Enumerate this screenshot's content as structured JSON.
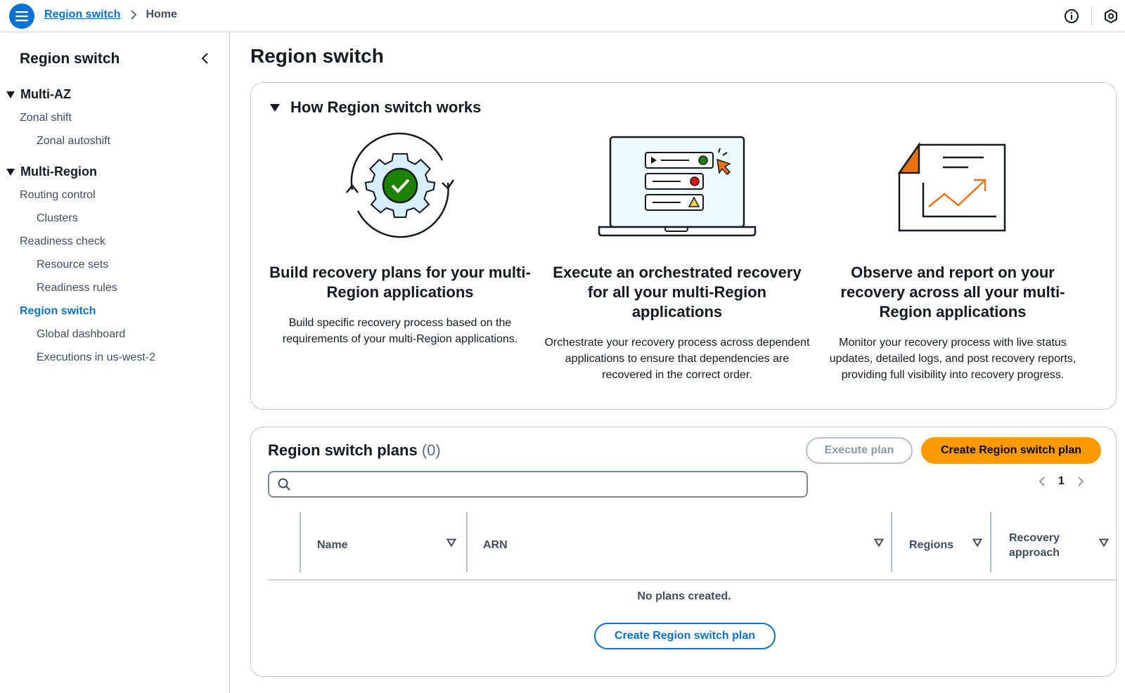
{
  "header": {
    "breadcrumb_link": "Region switch",
    "breadcrumb_current": "Home"
  },
  "sidebar": {
    "title": "Region switch",
    "sections": [
      {
        "label": "Multi-AZ"
      },
      {
        "label": "Multi-Region"
      }
    ],
    "items": [
      {
        "label": "Zonal shift"
      },
      {
        "label": "Zonal autoshift"
      },
      {
        "label": "Routing control"
      },
      {
        "label": "Clusters"
      },
      {
        "label": "Readiness check"
      },
      {
        "label": "Resource sets"
      },
      {
        "label": "Readiness rules"
      },
      {
        "label": "Region switch"
      },
      {
        "label": "Global dashboard"
      },
      {
        "label": "Executions in us-west-2"
      }
    ]
  },
  "main": {
    "title": "Region switch",
    "how": {
      "header": "How Region switch works",
      "features": [
        {
          "title": "Build recovery plans for your multi-Region applications",
          "desc": "Build specific recovery process based on the requirements of your multi-Region applications."
        },
        {
          "title": "Execute an orchestrated recovery for all your multi-Region applications",
          "desc": "Orchestrate your recovery process across dependent applications to ensure that dependencies are recovered in the correct order."
        },
        {
          "title": "Observe and report on your recovery across all your multi-Region applications",
          "desc": "Monitor your recovery process with live status updates, detailed logs, and post recovery reports, providing full visibility into recovery progress."
        }
      ]
    },
    "plans": {
      "title": "Region switch plans",
      "count": "(0)",
      "execute_label": "Execute plan",
      "create_label": "Create Region switch plan",
      "search_placeholder": "",
      "page": "1",
      "columns": [
        "Name",
        "ARN",
        "Regions",
        "Recovery approach"
      ],
      "empty_text": "No plans created.",
      "empty_create_label": "Create Region switch plan"
    }
  },
  "colors": {
    "accent": "#0972d3",
    "primary_button": "#ff9900",
    "success": "#1d8102",
    "error": "#d91515",
    "warning": "#f2cd54"
  }
}
